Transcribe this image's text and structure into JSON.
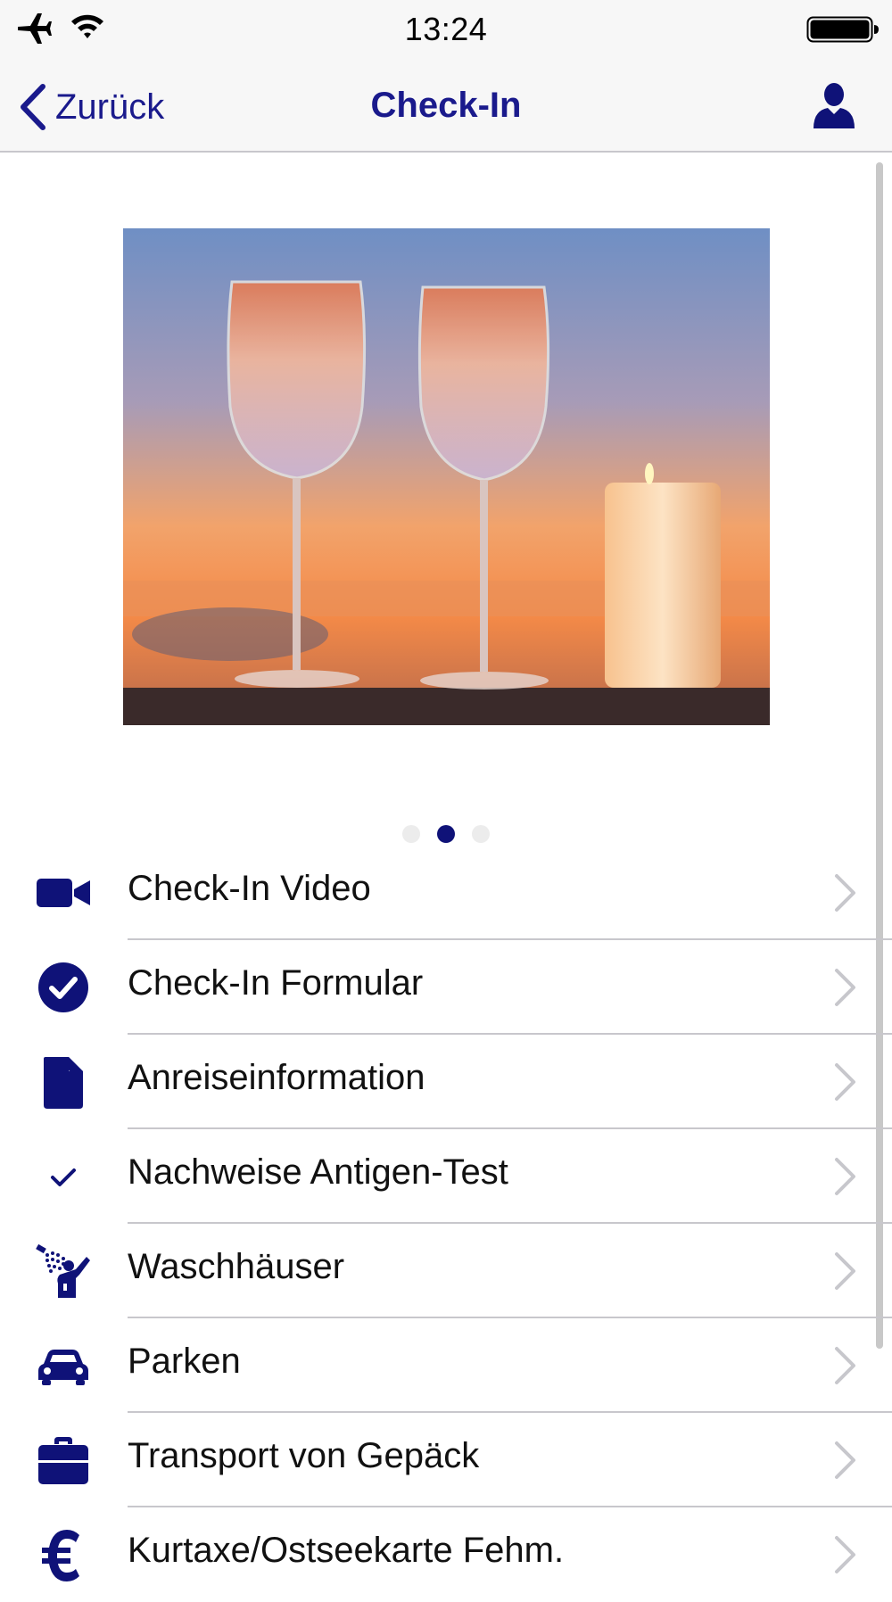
{
  "status_bar": {
    "time": "13:24",
    "icons": [
      "airplane-icon",
      "wifi-icon",
      "battery-icon"
    ]
  },
  "nav": {
    "back_label": "Zurück",
    "title": "Check-In",
    "profile_icon": "person-icon"
  },
  "carousel": {
    "image": "photo of two glasses of rosé wine and a lit candle at sunset",
    "page_count": 3,
    "active_page": 2
  },
  "menu": {
    "items": [
      {
        "label": "Check-In Video",
        "icon": "video-camera-icon"
      },
      {
        "label": "Check-In Formular",
        "icon": "check-circle-icon"
      },
      {
        "label": "Anreiseinformation",
        "icon": "document-icon"
      },
      {
        "label": "Nachweise Antigen-Test",
        "icon": "checkmark-icon"
      },
      {
        "label": "Waschhäuser",
        "icon": "shower-icon"
      },
      {
        "label": "Parken",
        "icon": "car-icon"
      },
      {
        "label": "Transport von Gepäck",
        "icon": "briefcase-icon"
      },
      {
        "label": "Kurtaxe/Ostseekarte Fehm.",
        "icon": "euro-icon"
      }
    ]
  },
  "colors": {
    "accent": "#1a1a8c",
    "icon": "#0f1278",
    "separator": "#c8c7cc",
    "bar_background": "#f7f7f7"
  }
}
